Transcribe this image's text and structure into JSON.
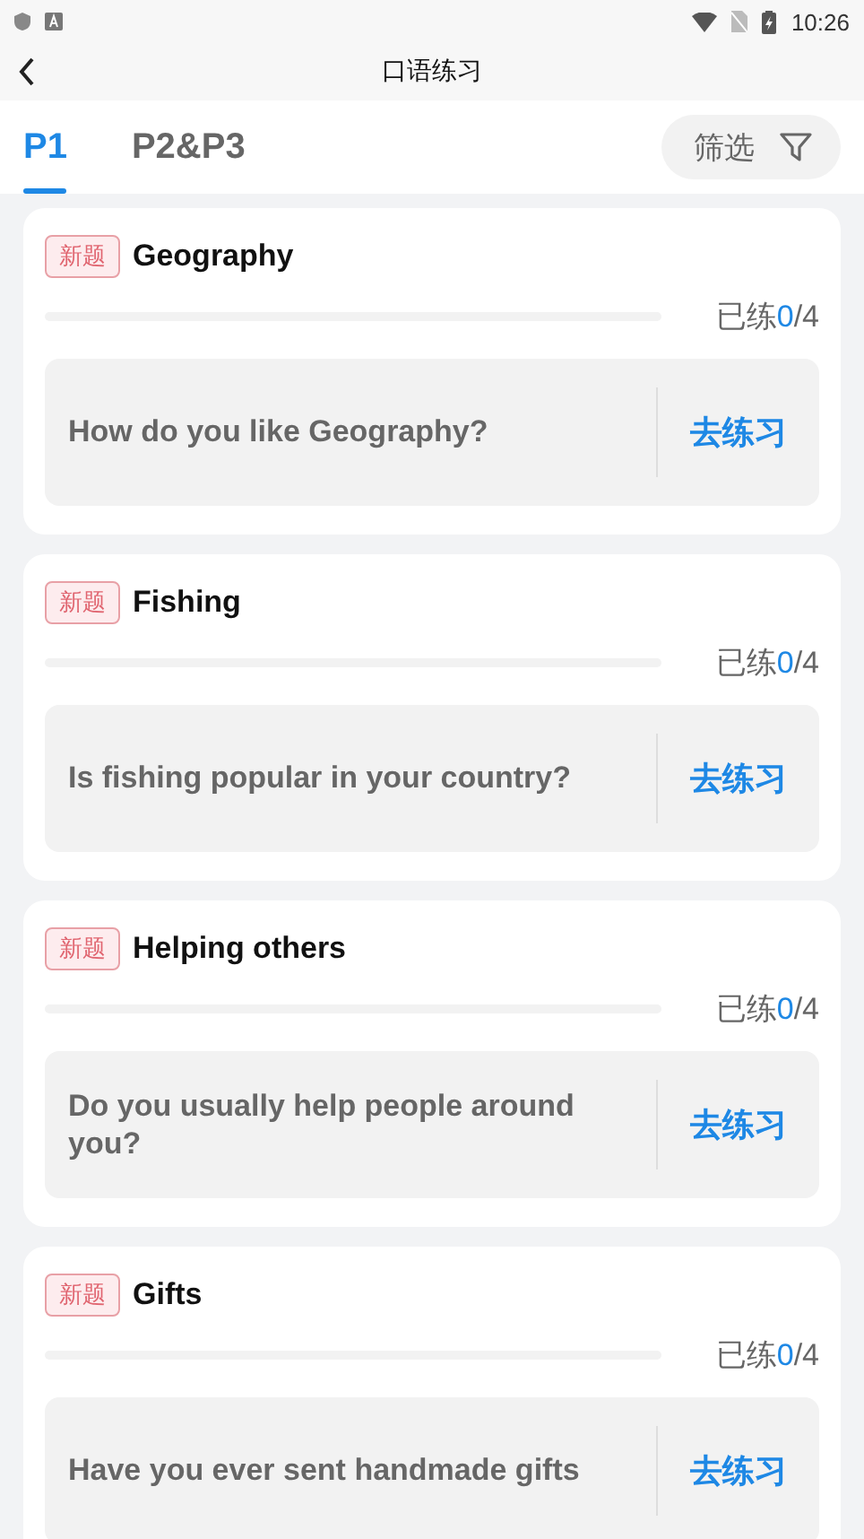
{
  "status_bar": {
    "time": "10:26"
  },
  "nav": {
    "title": "口语练习"
  },
  "tabs": [
    {
      "label": "P1",
      "selected": true
    },
    {
      "label": "P2&P3",
      "selected": false
    }
  ],
  "filter": {
    "label": "筛选"
  },
  "topics": [
    {
      "tag": "新题",
      "title": "Geography",
      "level": 0,
      "progress_label": "已练",
      "done": "0",
      "total": "/4",
      "question": "How do you like Geography?",
      "action": "去练习"
    },
    {
      "tag": "新题",
      "title": "Fishing",
      "level": 0,
      "progress_label": "已练",
      "done": "0",
      "total": "/4",
      "question": "Is fishing popular in your country?",
      "action": "去练习"
    },
    {
      "tag": "新题",
      "title": "Helping others",
      "level": 0,
      "progress_label": "已练",
      "done": "0",
      "total": "/4",
      "question": "Do you usually help people around you?",
      "action": "去练习"
    },
    {
      "tag": "新题",
      "title": "Gifts",
      "level": 0,
      "progress_label": "已练",
      "done": "0",
      "total": "/4",
      "question": "Have you ever sent handmade gifts",
      "action": "去练习"
    }
  ]
}
